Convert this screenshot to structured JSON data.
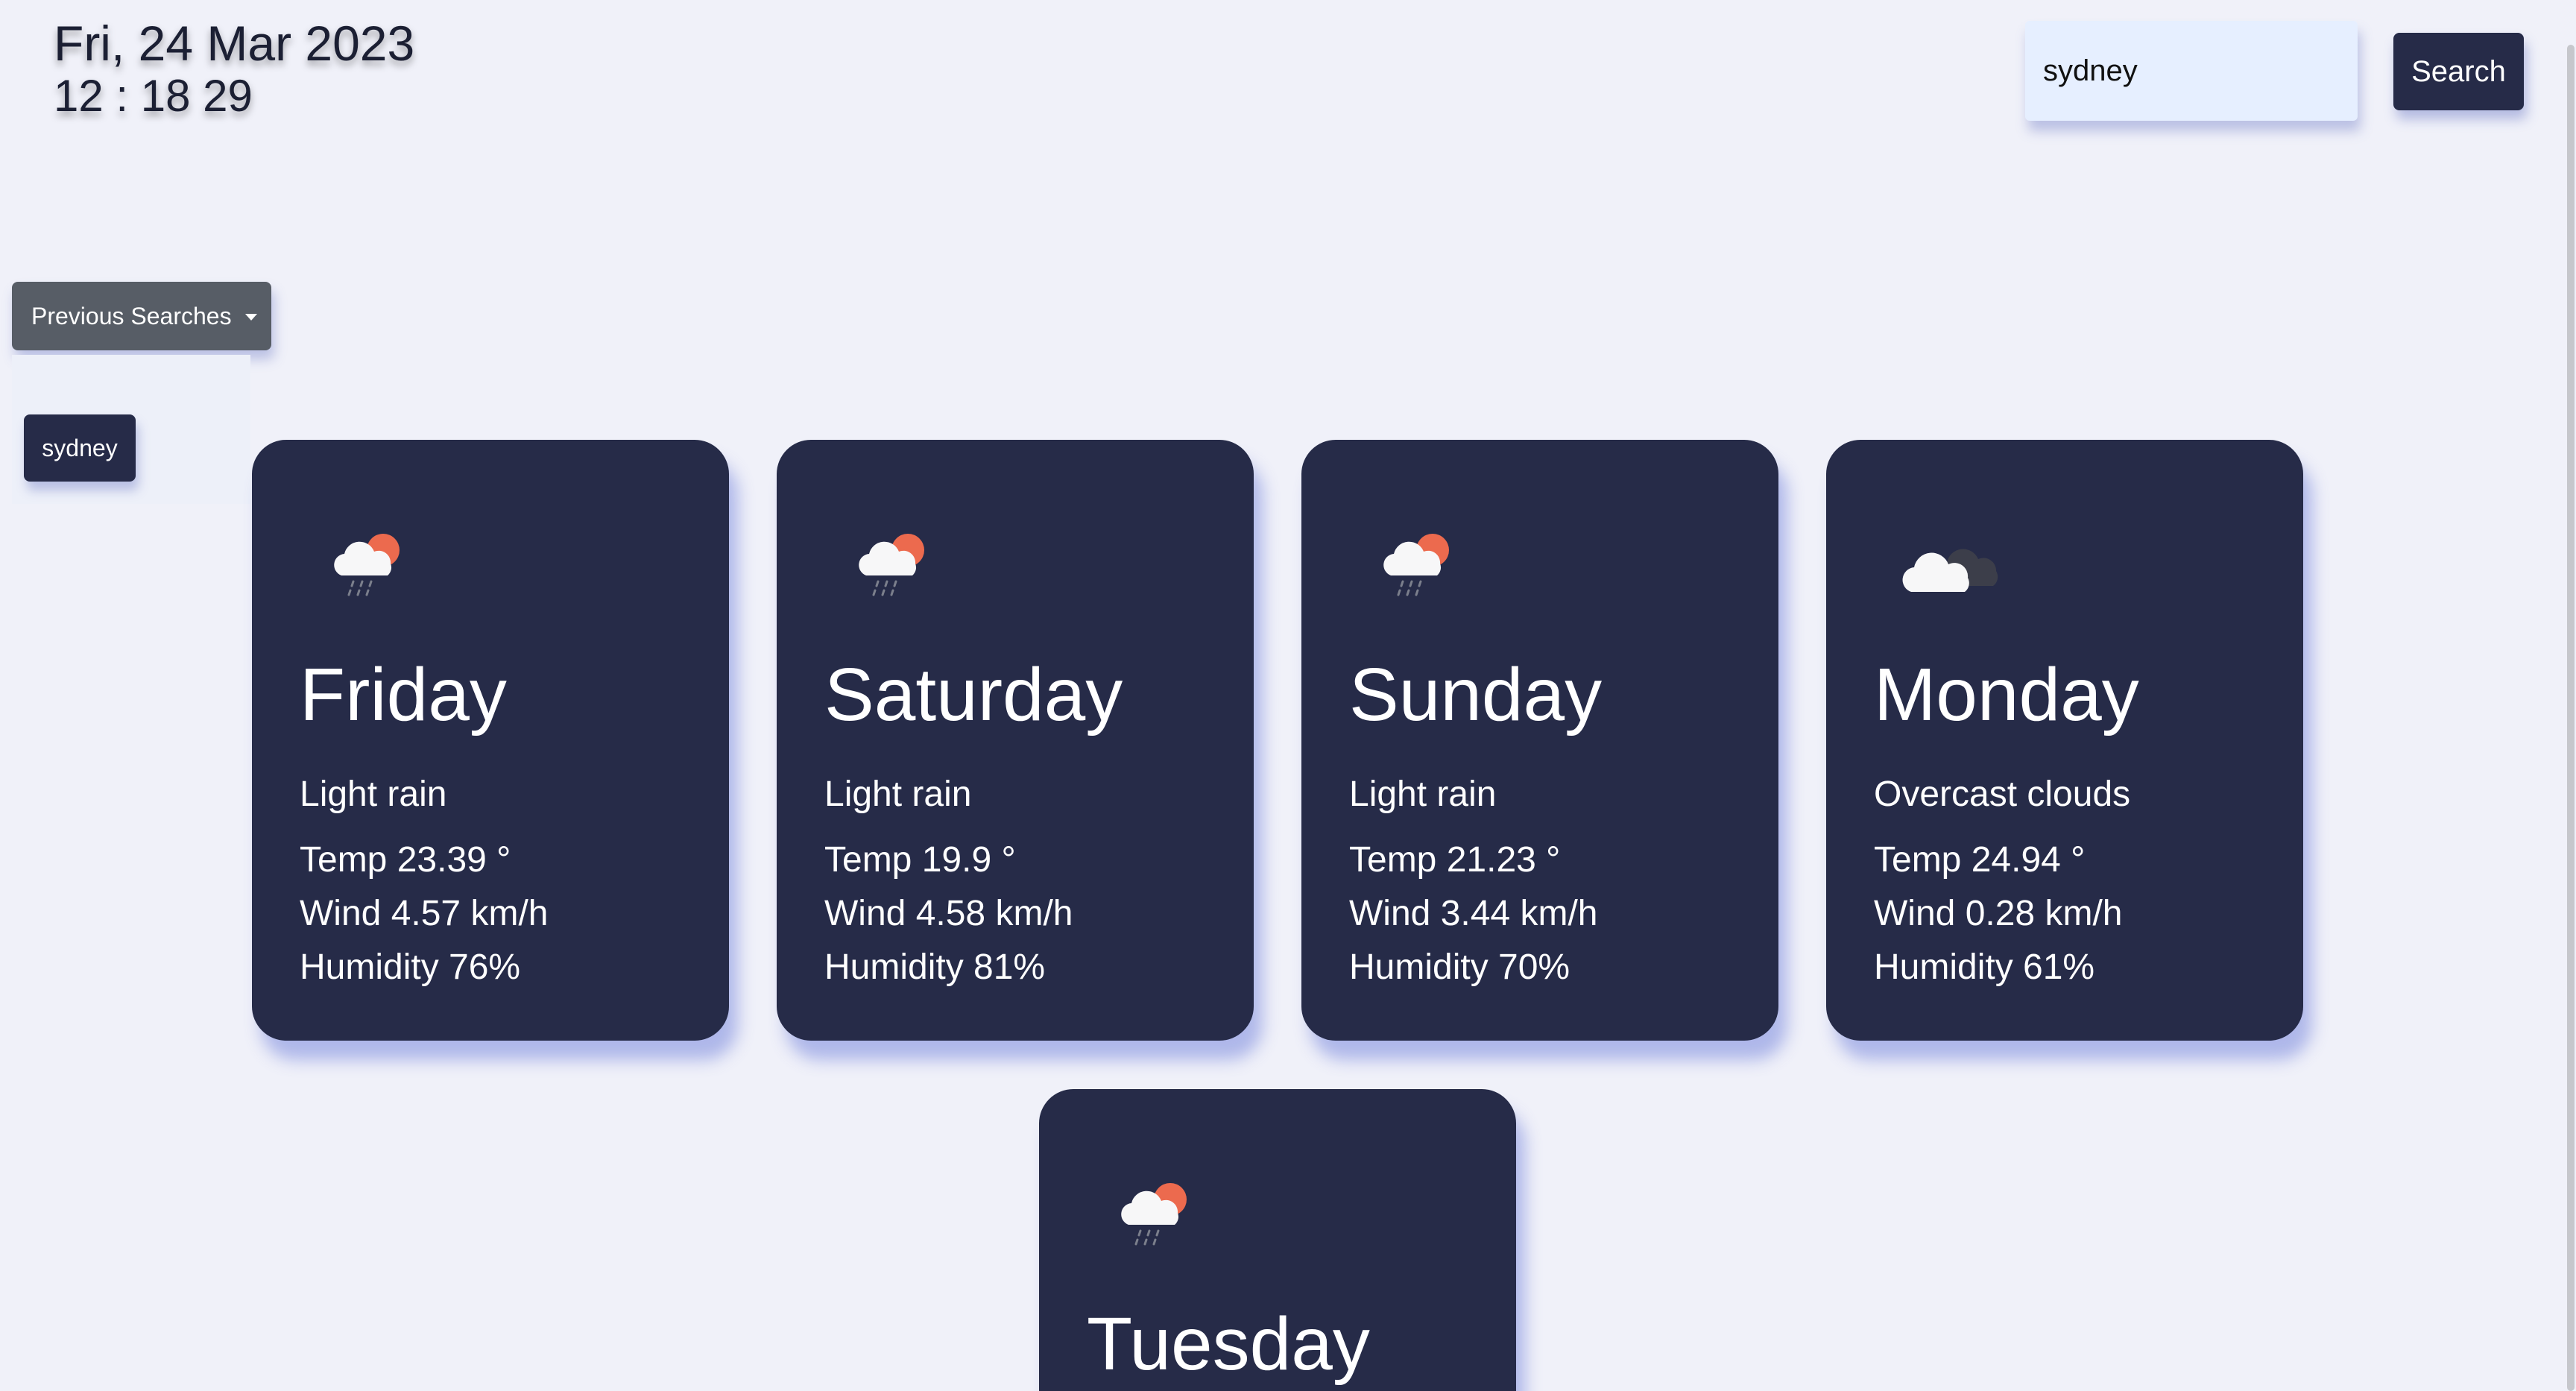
{
  "header": {
    "date": "Fri, 24 Mar 2023",
    "time": "12 : 18 29"
  },
  "search": {
    "value": "sydney",
    "button_label": "Search"
  },
  "previous_searches": {
    "button_label": "Previous Searches",
    "items": [
      "sydney"
    ]
  },
  "forecast": [
    {
      "day": "Friday",
      "icon": "light-rain-icon",
      "description": "Light rain",
      "temp": "Temp 23.39 °",
      "wind": "Wind 4.57 km/h",
      "humidity": "Humidity 76%"
    },
    {
      "day": "Saturday",
      "icon": "light-rain-icon",
      "description": "Light rain",
      "temp": "Temp 19.9 °",
      "wind": "Wind 4.58 km/h",
      "humidity": "Humidity 81%"
    },
    {
      "day": "Sunday",
      "icon": "light-rain-icon",
      "description": "Light rain",
      "temp": "Temp 21.23 °",
      "wind": "Wind 3.44 km/h",
      "humidity": "Humidity 70%"
    },
    {
      "day": "Monday",
      "icon": "overcast-clouds-icon",
      "description": "Overcast clouds",
      "temp": "Temp 24.94 °",
      "wind": "Wind 0.28 km/h",
      "humidity": "Humidity 61%"
    },
    {
      "day": "Tuesday",
      "icon": "light-rain-icon",
      "description": "",
      "temp": "",
      "wind": "",
      "humidity": ""
    }
  ],
  "colors": {
    "background": "#f0f1f9",
    "card": "#262b48",
    "search_input": "#e6efff",
    "prev_button": "#575d66",
    "sun": "#ec6a4e"
  }
}
